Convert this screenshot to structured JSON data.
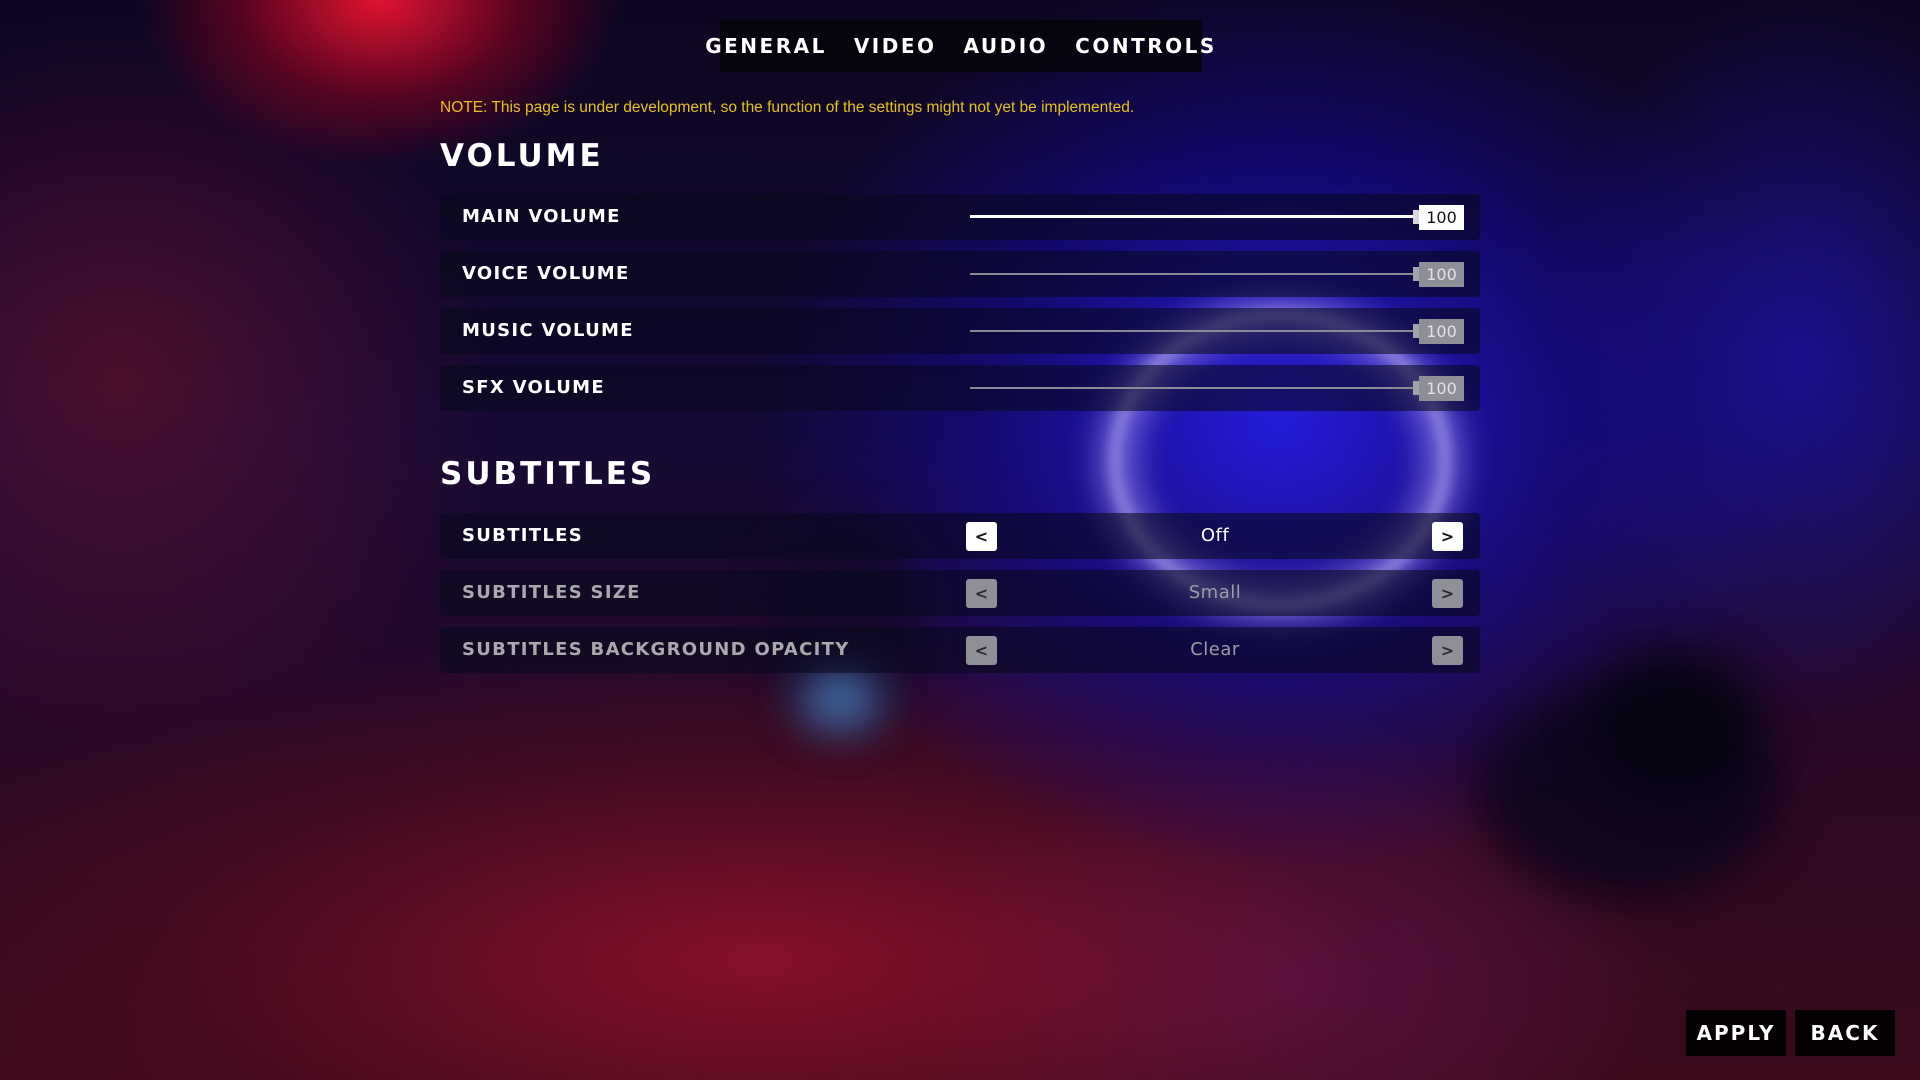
{
  "tabs": [
    {
      "label": "GENERAL"
    },
    {
      "label": "VIDEO"
    },
    {
      "label": "AUDIO"
    },
    {
      "label": "CONTROLS"
    }
  ],
  "note": "NOTE: This page is under development, so the function of the settings might not yet be implemented.",
  "volume": {
    "title": "VOLUME",
    "items": [
      {
        "label": "MAIN VOLUME",
        "value": "100",
        "level": 1.0
      },
      {
        "label": "VOICE VOLUME",
        "value": "100",
        "level": 1.0
      },
      {
        "label": "MUSIC VOLUME",
        "value": "100",
        "level": 1.0
      },
      {
        "label": "SFX VOLUME",
        "value": "100",
        "level": 1.0
      }
    ]
  },
  "subtitles": {
    "title": "SUBTITLES",
    "items": [
      {
        "label": "SUBTITLES",
        "value": "Off",
        "prev": "<",
        "next": ">"
      },
      {
        "label": "SUBTITLES SIZE",
        "value": "Small",
        "prev": "<",
        "next": ">"
      },
      {
        "label": "SUBTITLES BACKGROUND OPACITY",
        "value": "Clear",
        "prev": "<",
        "next": ">"
      }
    ]
  },
  "buttons": {
    "apply": "APPLY",
    "back": "BACK"
  },
  "colors": {
    "note": "#e5c21b",
    "active": "#ffffff",
    "inactive": "#8e8e96"
  }
}
